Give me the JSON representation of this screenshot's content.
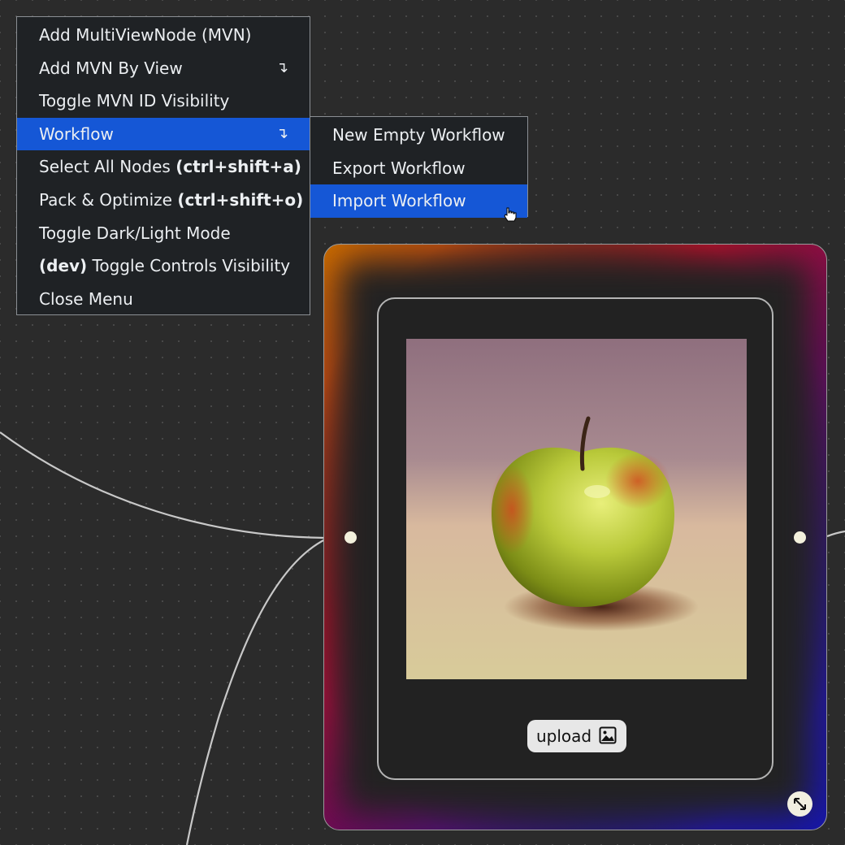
{
  "main_menu": {
    "items": [
      {
        "label": "Add MultiViewNode (MVN)",
        "shortcut": "",
        "arrow": ""
      },
      {
        "label": "Add MVN By View",
        "shortcut": "",
        "arrow": "↴"
      },
      {
        "label": "Toggle MVN ID Visibility",
        "shortcut": "",
        "arrow": ""
      },
      {
        "label": "Workflow",
        "shortcut": "",
        "arrow": "↴",
        "active": true
      },
      {
        "label": "Select All Nodes ",
        "shortcut": "(ctrl+shift+a)",
        "arrow": ""
      },
      {
        "label": "Pack & Optimize ",
        "shortcut": "(ctrl+shift+o)",
        "arrow": ""
      },
      {
        "label": "Toggle Dark/Light Mode",
        "shortcut": "",
        "arrow": ""
      },
      {
        "prefix": "(dev)",
        "label": " Toggle Controls Visibility",
        "arrow": ""
      },
      {
        "label": "Close Menu",
        "shortcut": "",
        "arrow": ""
      }
    ]
  },
  "workflow_submenu": {
    "items": [
      {
        "label": "New Empty Workflow"
      },
      {
        "label": "Export Workflow"
      },
      {
        "label": "Import Workflow",
        "active": true
      }
    ]
  },
  "node": {
    "upload_label": "upload",
    "image_subject": "green-red apple on table",
    "gradient_colors": [
      "#c76a00",
      "#b5102a",
      "#6a0b55",
      "#2b1790",
      "#1616a8"
    ]
  },
  "colors": {
    "canvas_bg": "#2b2b2b",
    "menu_bg": "#1f2225",
    "menu_active": "#1557d6",
    "edge": "#c8c8c8",
    "handle": "#f3f0dc"
  }
}
